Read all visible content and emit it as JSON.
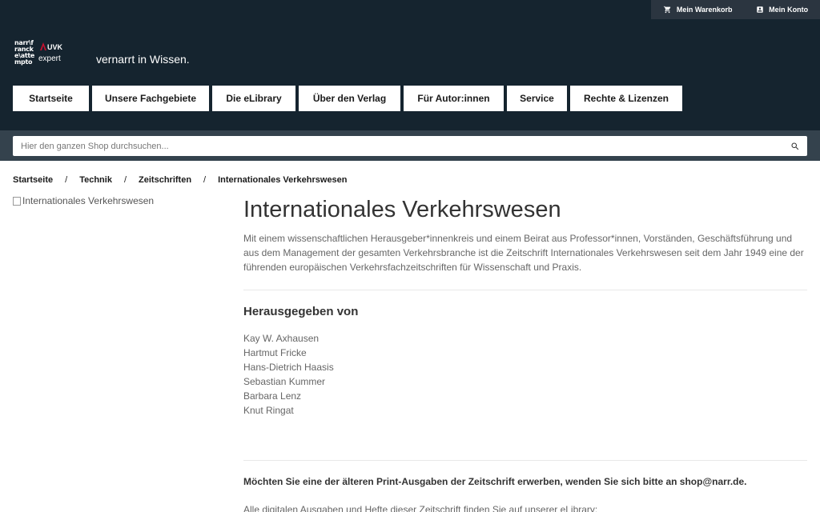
{
  "topbar": {
    "cart_label": "Mein Warenkorb",
    "account_label": "Mein Konto"
  },
  "logo": {
    "narr_lines": [
      "narr\\f",
      "ranck",
      "e\\atte",
      "mpto"
    ],
    "uvk": "UVK",
    "expert": "expert"
  },
  "tagline": "vernarrt in Wissen.",
  "nav": {
    "items": [
      {
        "label": "Startseite"
      },
      {
        "label": "Unsere Fachgebiete"
      },
      {
        "label": "Die eLibrary"
      },
      {
        "label": "Über den Verlag"
      },
      {
        "label": "Für Autor:innen"
      },
      {
        "label": "Service"
      },
      {
        "label": "Rechte & Lizenzen"
      }
    ]
  },
  "search": {
    "placeholder": "Hier den ganzen Shop durchsuchen...",
    "value": ""
  },
  "breadcrumb": {
    "items": [
      "Startseite",
      "Technik",
      "Zeitschriften",
      "Internationales Verkehrswesen"
    ],
    "separator": "/"
  },
  "product": {
    "image_alt": "Internationales Verkehrswesen",
    "title": "Internationales Verkehrswesen",
    "description": "Mit einem wissenschaftlichen Herausgeber*innenkreis und einem Beirat aus Professor*innen, Vorständen, Geschäftsführung und aus dem Management der gesamten Verkehrsbranche ist die Zeitschrift Internationales Verkehrswesen seit dem Jahr 1949 eine der führenden europäischen Verkehrsfachzeitschriften für Wissenschaft und Praxis.",
    "editors_heading": "Herausgegeben von",
    "editors": [
      "Kay W. Axhausen",
      "Hartmut Fricke",
      "Hans-Dietrich Haasis",
      "Sebastian Kummer",
      "Barbara Lenz",
      "Knut Ringat"
    ],
    "print_note": "Möchten Sie eine der älteren Print-Ausgaben der Zeitschrift erwerben, wenden Sie sich bitte an shop@narr.de.",
    "digital_note": "Alle digitalen Ausgaben und Hefte dieser Zeitschrift finden Sie auf unserer eLibrary:"
  },
  "colors": {
    "header_bg": "#15242f",
    "searchbar_bg": "#34424d",
    "accent_red": "#c8102e"
  }
}
